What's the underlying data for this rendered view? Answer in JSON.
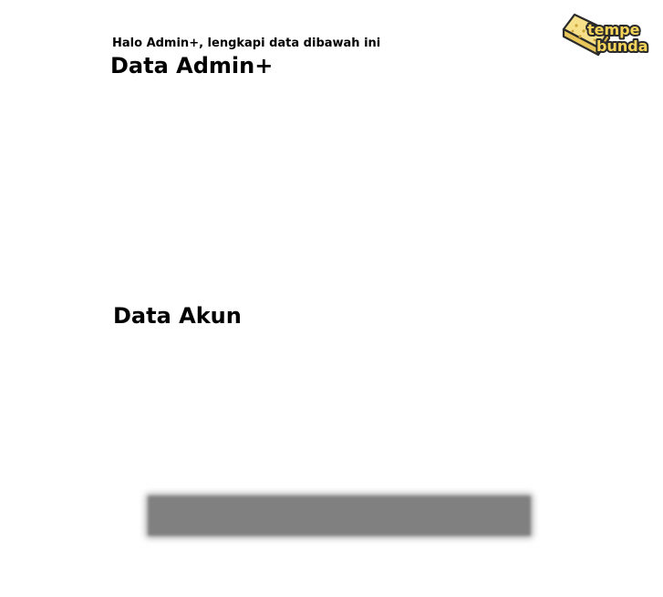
{
  "header": {
    "greeting": "Halo Admin+, lengkapi data dibawah ini",
    "title": "Data Admin+"
  },
  "logo": {
    "line1": "tempe",
    "line2": "bunda",
    "colors": {
      "fill": "#f7e08a",
      "outline": "#2a2a2a",
      "text": "#f6d45a"
    }
  },
  "sections": {
    "account_title": "Data Akun"
  },
  "submit": {
    "color": "#808080"
  }
}
